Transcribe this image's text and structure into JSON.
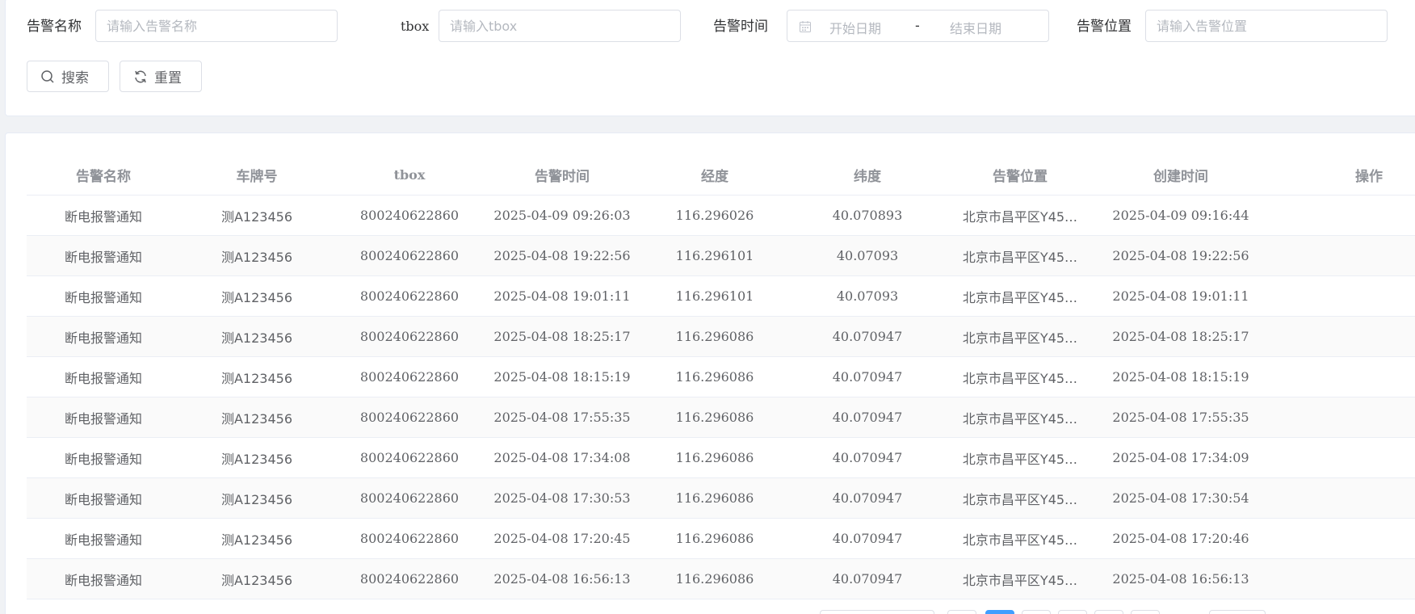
{
  "search": {
    "alarm_name_label": "告警名称",
    "alarm_name_placeholder": "请输入告警名称",
    "tbox_label": "tbox",
    "tbox_placeholder": "请输入tbox",
    "alarm_time_label": "告警时间",
    "start_date_placeholder": "开始日期",
    "range_separator": "-",
    "end_date_placeholder": "结束日期",
    "alarm_location_label": "告警位置",
    "alarm_location_placeholder": "请输入告警位置",
    "search_button": "搜索",
    "reset_button": "重置"
  },
  "table": {
    "columns": [
      "告警名称",
      "车牌号",
      "tbox",
      "告警时间",
      "经度",
      "纬度",
      "告警位置",
      "创建时间",
      "操作"
    ],
    "rows": [
      [
        "断电报警通知",
        "测A123456",
        "800240622860",
        "2025-04-09 09:26:03",
        "116.296026",
        "40.070893",
        "北京市昌平区Y45…",
        "2025-04-09 09:16:44",
        ""
      ],
      [
        "断电报警通知",
        "测A123456",
        "800240622860",
        "2025-04-08 19:22:56",
        "116.296101",
        "40.07093",
        "北京市昌平区Y45…",
        "2025-04-08 19:22:56",
        ""
      ],
      [
        "断电报警通知",
        "测A123456",
        "800240622860",
        "2025-04-08 19:01:11",
        "116.296101",
        "40.07093",
        "北京市昌平区Y45…",
        "2025-04-08 19:01:11",
        ""
      ],
      [
        "断电报警通知",
        "测A123456",
        "800240622860",
        "2025-04-08 18:25:17",
        "116.296086",
        "40.070947",
        "北京市昌平区Y45…",
        "2025-04-08 18:25:17",
        ""
      ],
      [
        "断电报警通知",
        "测A123456",
        "800240622860",
        "2025-04-08 18:15:19",
        "116.296086",
        "40.070947",
        "北京市昌平区Y45…",
        "2025-04-08 18:15:19",
        ""
      ],
      [
        "断电报警通知",
        "测A123456",
        "800240622860",
        "2025-04-08 17:55:35",
        "116.296086",
        "40.070947",
        "北京市昌平区Y45…",
        "2025-04-08 17:55:35",
        ""
      ],
      [
        "断电报警通知",
        "测A123456",
        "800240622860",
        "2025-04-08 17:34:08",
        "116.296086",
        "40.070947",
        "北京市昌平区Y45…",
        "2025-04-08 17:34:09",
        ""
      ],
      [
        "断电报警通知",
        "测A123456",
        "800240622860",
        "2025-04-08 17:30:53",
        "116.296086",
        "40.070947",
        "北京市昌平区Y45…",
        "2025-04-08 17:30:54",
        ""
      ],
      [
        "断电报警通知",
        "测A123456",
        "800240622860",
        "2025-04-08 17:20:45",
        "116.296086",
        "40.070947",
        "北京市昌平区Y45…",
        "2025-04-08 17:20:46",
        ""
      ],
      [
        "断电报警通知",
        "测A123456",
        "800240622860",
        "2025-04-08 16:56:13",
        "116.296086",
        "40.070947",
        "北京市昌平区Y45…",
        "2025-04-08 16:56:13",
        ""
      ]
    ]
  },
  "pagination": {
    "active_color": "#409eff"
  }
}
